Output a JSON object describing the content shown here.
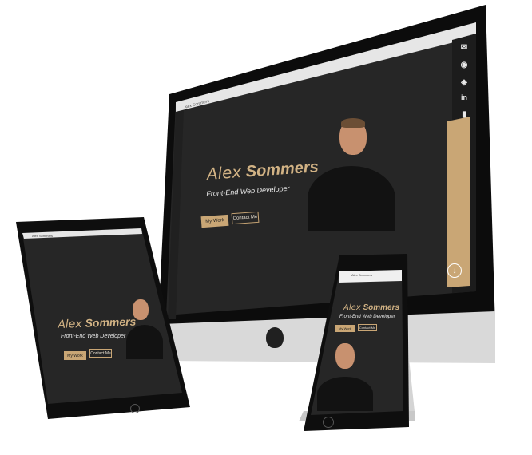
{
  "colors": {
    "accent": "#c9a675",
    "screen_bg": "#262626",
    "device": "#111111"
  },
  "monitor": {
    "tab_title": "Alex Sommers",
    "first_name": "Alex",
    "last_name": "Sommers",
    "subtitle": "Front-End Web Developer",
    "primary_button": "My Work",
    "secondary_button": "Contact Me",
    "sidebar_icons": [
      "mail-icon",
      "github-icon",
      "codepen-icon",
      "linkedin-icon",
      "resume-icon"
    ],
    "scroll_icon": "arrow-down-icon"
  },
  "tablet": {
    "tab_title": "Alex Sommers",
    "first_name": "Alex",
    "last_name": "Sommers",
    "subtitle": "Front-End Web Developer",
    "primary_button": "My Work",
    "secondary_button": "Contact Me"
  },
  "phone": {
    "url": "Alex Sommers",
    "first_name": "Alex",
    "last_name": "Sommers",
    "subtitle": "Front-End Web Developer",
    "primary_button": "My Work",
    "secondary_button": "Contact Me"
  }
}
